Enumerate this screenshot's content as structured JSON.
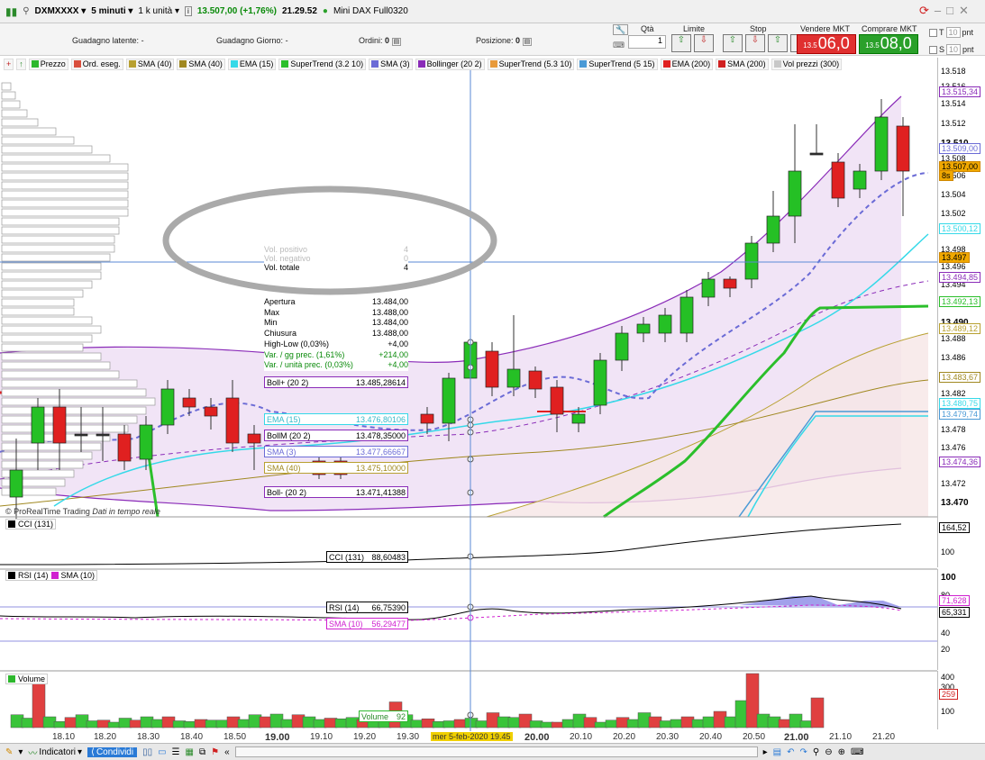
{
  "toolbar": {
    "symbol": "DXMXXXX",
    "timeframe": "5 minuti",
    "units": "1 k unità",
    "price_info": "13.507,00 (+1,76%)",
    "time": "21.29.52",
    "instrument": "Mini DAX Full0320"
  },
  "status": {
    "latent_gain_label": "Guadagno latente:",
    "latent_gain_value": "-",
    "day_gain_label": "Guadagno Giorno:",
    "day_gain_value": "-",
    "orders_label": "Ordini:",
    "orders_value": "0",
    "position_label": "Posizione:",
    "position_value": "0"
  },
  "order_panel": {
    "qty_label": "Qtà",
    "qty_value": "1",
    "limit_label": "Limite",
    "stop_label": "Stop",
    "sell_label": "Vendere MKT",
    "sell_small": "13.5",
    "sell_big": "06,0",
    "buy_label": "Comprare MKT",
    "buy_small": "13.5",
    "buy_big": "08,0",
    "t_label": "T",
    "t_value": "10",
    "t_unit": "pnt",
    "s_label": "S",
    "s_value": "10",
    "s_unit": "pnt"
  },
  "legend": [
    {
      "label": "Prezzo",
      "color": "#2db82d"
    },
    {
      "label": "Ord. eseg.",
      "color": "#d94f3d"
    },
    {
      "label": "SMA (40)",
      "color": "#b8a030"
    },
    {
      "label": "SMA (40)",
      "color": "#a08820"
    },
    {
      "label": "EMA (15)",
      "color": "#35d9e8"
    },
    {
      "label": "SuperTrend (3.2 10)",
      "color": "#2bbf2b"
    },
    {
      "label": "SMA (3)",
      "color": "#6b6bd6"
    },
    {
      "label": "Bollinger (20 2)",
      "color": "#8a2bb8"
    },
    {
      "label": "SuperTrend (5.3 10)",
      "color": "#e89a3a"
    },
    {
      "label": "SuperTrend (5 15)",
      "color": "#4a9ad6"
    },
    {
      "label": "EMA (200)",
      "color": "#e02020"
    },
    {
      "label": "SMA (200)",
      "color": "#d02020"
    },
    {
      "label": "Vol prezzi (300)",
      "color": "#c8c8c8"
    }
  ],
  "price_axis": {
    "ticks": [
      "13.518",
      "13.516",
      "13.514",
      "13.512",
      "13.510",
      "13.508",
      "13.506",
      "13.504",
      "13.502",
      "13.498",
      "13.496",
      "13.494",
      "13.490",
      "13.488",
      "13.486",
      "13.482",
      "13.478",
      "13.476",
      "13.472",
      "13.470"
    ],
    "tags": [
      {
        "text": "13.515,34",
        "color": "#8a2bb8"
      },
      {
        "text": "13.509,00",
        "color": "#6b6bd6"
      },
      {
        "text": "13.507,00",
        "color": "#d08800"
      },
      {
        "text": "8s",
        "color": "#d08800"
      },
      {
        "text": "13.500,12",
        "color": "#35d9e8"
      },
      {
        "text": "13.497",
        "color": "#d08800"
      },
      {
        "text": "13.494,85",
        "color": "#8a2bb8"
      },
      {
        "text": "13.492,13",
        "color": "#2bbf2b"
      },
      {
        "text": "13.489,12",
        "color": "#b8a030"
      },
      {
        "text": "13.483,67",
        "color": "#a08820"
      },
      {
        "text": "13.480,75",
        "color": "#35d9e8"
      },
      {
        "text": "13.479,74",
        "color": "#4a9ad6"
      },
      {
        "text": "13.474,36",
        "color": "#8a2bb8"
      }
    ]
  },
  "tooltip": {
    "vol_pos_label": "Vol. positivo",
    "vol_pos": "4",
    "vol_neg_label": "Vol. negativo",
    "vol_neg": "0",
    "vol_tot_label": "Vol. totale",
    "vol_tot": "4",
    "open_label": "Apertura",
    "open": "13.484,00",
    "max_label": "Max",
    "max": "13.488,00",
    "min_label": "Min",
    "min": "13.484,00",
    "close_label": "Chiusura",
    "close": "13.488,00",
    "hl_label": "High-Low (0,03%)",
    "hl": "+4,00",
    "var_day_label": "Var. / gg prec. (1,61%)",
    "var_day": "+214,00",
    "var_unit_label": "Var. / unità prec. (0,03%)",
    "var_unit": "+4,00"
  },
  "indicator_values": {
    "bollp_label": "Boll+ (20 2)",
    "bollp": "13.485,28614",
    "ema_label": "EMA (15)",
    "ema": "13.476,80106",
    "bollm_label": "BollM (20 2)",
    "bollm": "13.478,35000",
    "sma3_label": "SMA (3)",
    "sma3": "13.477,66667",
    "sma40_label": "SMA (40)",
    "sma40": "13.475,10000",
    "bollminus_label": "Boll- (20 2)",
    "bollminus": "13.471,41388"
  },
  "watermark": "© ProRealTime Trading",
  "watermark2": "Dati in tempo reale",
  "cci": {
    "header": "CCI (131)",
    "label": "CCI (131)",
    "value": "88,60483",
    "ticks": [
      "150",
      "100"
    ],
    "tag": "164,52"
  },
  "rsi": {
    "header1": "RSI (14)",
    "header2": "SMA (10)",
    "rsi_label": "RSI (14)",
    "rsi_value": "66,75390",
    "sma_label": "SMA (10)",
    "sma_value": "56,29477",
    "ticks": [
      "100",
      "80",
      "40",
      "20"
    ],
    "tag1": "71,628",
    "tag2": "65,331"
  },
  "volume": {
    "header": "Volume",
    "label": "Volume",
    "value": "92",
    "ticks": [
      "400",
      "300",
      "200",
      "100"
    ],
    "tag": "259",
    "values": [
      95,
      70,
      380,
      80,
      45,
      75,
      95,
      50,
      55,
      40,
      70,
      55,
      80,
      60,
      80,
      50,
      45,
      60,
      55,
      55,
      80,
      60,
      95,
      80,
      100,
      60,
      95,
      80,
      60,
      70,
      65,
      75,
      60,
      95,
      80,
      190,
      95,
      55,
      65,
      45,
      50,
      60,
      70,
      50,
      110,
      80,
      75,
      100,
      50,
      40,
      40,
      60,
      100,
      75,
      40,
      55,
      75,
      60,
      110,
      80,
      50,
      60,
      80,
      60,
      80,
      120,
      80,
      200,
      400,
      100,
      80,
      60,
      100,
      50,
      220
    ]
  },
  "time_axis": {
    "labels": [
      "18.10",
      "18.20",
      "18.30",
      "18.40",
      "18.50",
      "19.00",
      "19.10",
      "19.20",
      "19.30",
      "mer 5-feb-2020 19.45",
      "20.00",
      "20.10",
      "20.20",
      "20.30",
      "20.40",
      "20.50",
      "21.00",
      "21.10",
      "21.20"
    ]
  },
  "bottom": {
    "indicators_label": "Indicatori",
    "share_label": "Condividi"
  }
}
